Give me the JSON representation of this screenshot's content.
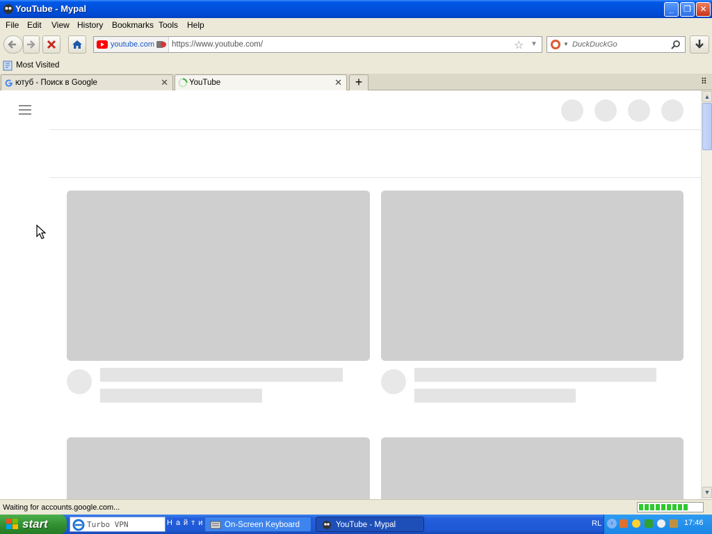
{
  "window": {
    "title": "YouTube - Mypal"
  },
  "menu": [
    "File",
    "Edit",
    "View",
    "History",
    "Bookmarks",
    "Tools",
    "Help"
  ],
  "urlbar": {
    "identity": "youtube.com",
    "url": "https://www.youtube.com/"
  },
  "search": {
    "placeholder": "DuckDuckGo"
  },
  "bookmarks": {
    "most_visited": "Most Visited"
  },
  "tabs": [
    {
      "label": "ютуб - Поиск в Google",
      "active": false
    },
    {
      "label": "YouTube",
      "active": true
    }
  ],
  "status": {
    "text": "Waiting for accounts.google.com...",
    "progress_fraction": 0.8
  },
  "taskbar": {
    "start": "start",
    "quicklaunch": "Turbo VPN",
    "search_hint": "Найти",
    "items": [
      "On-Screen Keyboard",
      "YouTube - Mypal"
    ],
    "tray_lang": "RL",
    "clock": "17:46"
  },
  "colors": {
    "titlebar": "#0058e6",
    "placeholder": "#cfcfcf",
    "youtube_red": "#ff0000"
  }
}
